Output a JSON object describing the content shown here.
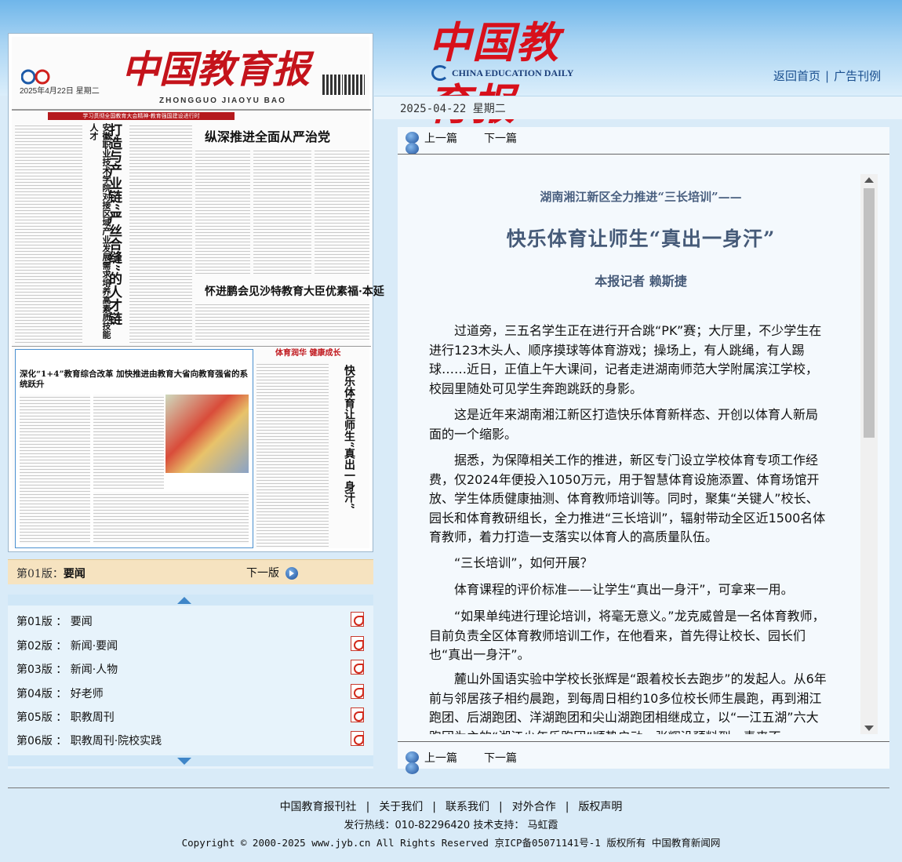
{
  "header": {
    "logo_cn": "中国教育报",
    "logo_en": "CHINA EDUCATION DAILY",
    "links": [
      "返回首页",
      "广告刊例"
    ],
    "date": "2025-04-22 星期二"
  },
  "newspaper": {
    "title": "中国教育报",
    "pinyin": "ZHONGGUO JIAOYU BAO",
    "date_line": "2025年4月22日 星期二",
    "banner": "学习贯彻全国教育大会精神·教育强国建设进行时",
    "headline_vertical_1": "打造与产业链“严丝合缝”的人才链",
    "headline_vertical_2": "安徽职业技术学院对接区域产业发展需求培养高素质技能人才",
    "headline_top": "纵深推进全面从严治党",
    "headline_mid": "怀进鹏会见沙特教育大臣优素福·本延",
    "headline_low": "深化“1+4”教育综合改革 加快推进由教育大省向教育强省的系统跃升",
    "headline_right": "快乐体育让师生“真出一身汗”",
    "section_tag": "体育润华 健康成长"
  },
  "version_bar": {
    "current_prefix": "第01版：",
    "current_name": "要闻",
    "next_label": "下一版"
  },
  "editions": [
    {
      "label": "第01版 ： 要闻"
    },
    {
      "label": "第02版 ： 新闻·要闻"
    },
    {
      "label": "第03版 ： 新闻·人物"
    },
    {
      "label": "第04版 ： 好老师"
    },
    {
      "label": "第05版 ： 职教周刊"
    },
    {
      "label": "第06版 ： 职教周刊·院校实践"
    }
  ],
  "article_nav": {
    "prev": "上一篇",
    "next": "下一篇"
  },
  "article": {
    "pretitle": "湖南湘江新区全力推进“三长培训”——",
    "title": "快乐体育让师生“真出一身汗”",
    "author": "本报记者  赖斯捷",
    "paragraphs": [
      "过道旁，三五名学生正在进行开合跳“PK”赛；大厅里，不少学生在进行123木头人、顺序摸球等体育游戏；操场上，有人跳绳，有人踢球……近日，正值上午大课间，记者走进湖南师范大学附属滨江学校，校园里随处可见学生奔跑跳跃的身影。",
      "这是近年来湖南湘江新区打造快乐体育新样态、开创以体育人新局面的一个缩影。",
      "据悉，为保障相关工作的推进，新区专门设立学校体育专项工作经费，仅2024年便投入1050万元，用于智慧体育设施添置、体育场馆开放、学生体质健康抽测、体育教师培训等。同时，聚集“关键人”校长、园长和体育教研组长，全力推进“三长培训”，辐射带动全区近1500名体育教师，着力打造一支落实以体育人的高质量队伍。",
      "“三长培训”，如何开展？",
      "体育课程的评价标准——让学生“真出一身汗”，可拿来一用。",
      "“如果单纯进行理论培训，将毫无意义。”龙克威曾是一名体育教师，目前负责全区体育教师培训工作，在他看来，首先得让校长、园长们也“真出一身汗”。",
      "麓山外国语实验中学校长张辉是“跟着校长去跑步”的发起人。从6年前与邻居孩子相约晨跑，到每周日相约10多位校长师生晨跑，再到湘江跑团、后湖跑团、洋湖跑团和尖山湖跑团相继成立，以“一江五湖”六大跑团为主的“湘江少年乐跑团”顺势启动，张辉没预料到，素来不"
    ]
  },
  "footer": {
    "links": [
      "中国教育报刊社",
      "关于我们",
      "联系我们",
      "对外合作",
      "版权声明"
    ],
    "hotline": "发行热线：010-82296420 技术支持： 马虹霞",
    "copyright": "Copyright © 2000-2025 www.jyb.cn All Rights Reserved 京ICP备05071141号-1 版权所有 中国教育新闻网"
  },
  "colors": {
    "logo_red": "#d8101b",
    "link_blue": "#1a4f8f",
    "title_slate": "#455a78",
    "version_bar": "#f6e3c0",
    "panel_bg": "#f4f9fd"
  }
}
